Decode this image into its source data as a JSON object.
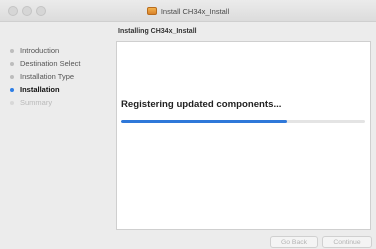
{
  "window": {
    "title": "Install CH34x_Install",
    "header": "Installing CH34x_Install"
  },
  "sidebar": {
    "items": [
      {
        "label": "Introduction",
        "state": "done"
      },
      {
        "label": "Destination Select",
        "state": "done"
      },
      {
        "label": "Installation Type",
        "state": "done"
      },
      {
        "label": "Installation",
        "state": "active"
      },
      {
        "label": "Summary",
        "state": "future"
      }
    ]
  },
  "main": {
    "status": "Registering updated components...",
    "progress_fraction": 0.68
  },
  "buttons": {
    "back": "Go Back",
    "continue": "Continue"
  },
  "colors": {
    "accent": "#2f78d9"
  }
}
